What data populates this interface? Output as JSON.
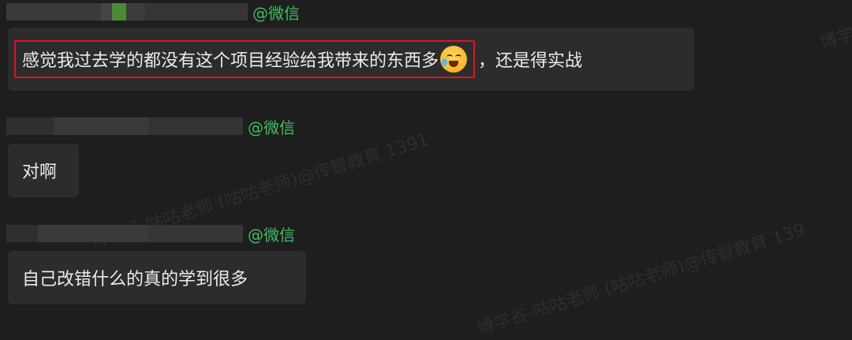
{
  "watermark": {
    "line1": "博学谷-咕咕老师 (咕咕老师)@传智教育 1391",
    "line2": "博学谷-咕咕老师 (咕咕老师)@传智教育 139",
    "top_right": "博学"
  },
  "messages": [
    {
      "sender_tag": "@微信",
      "highlighted_text": "感觉我过去学的都没有这个项目经验给我带来的东西多",
      "emoji_icon": "face-with-tears-of-joy-icon",
      "rest_text": "，还是得实战"
    },
    {
      "sender_tag": "@微信",
      "text": "对啊"
    },
    {
      "sender_tag": "@微信",
      "text": "自己改错什么的真的学到很多"
    }
  ],
  "colors": {
    "highlight_border": "#e0141e",
    "sender_tag": "#3fbf5f",
    "bubble": "#2c2c2c"
  }
}
